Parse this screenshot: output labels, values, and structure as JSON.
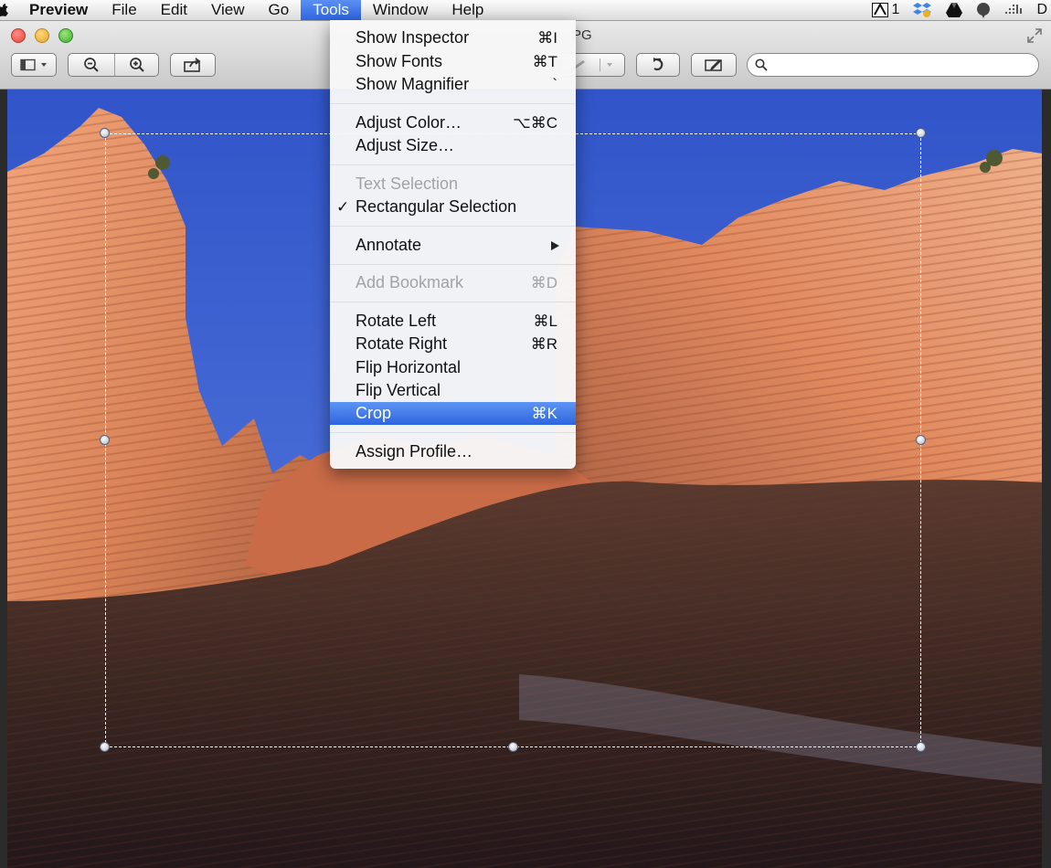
{
  "menubar": {
    "app": "Preview",
    "items": [
      "File",
      "Edit",
      "View",
      "Go",
      "Tools",
      "Window",
      "Help"
    ],
    "active": "Tools",
    "status_badge_count": "1",
    "status_partial": "D"
  },
  "window": {
    "title_fragment": "PG"
  },
  "search": {
    "placeholder": "",
    "value": ""
  },
  "tools_menu": {
    "show_inspector": {
      "label": "Show Inspector",
      "shortcut": "⌘I"
    },
    "show_fonts": {
      "label": "Show Fonts",
      "shortcut": "⌘T"
    },
    "show_magnifier": {
      "label": "Show Magnifier",
      "shortcut": "`"
    },
    "adjust_color": {
      "label": "Adjust Color…",
      "shortcut": "⌥⌘C"
    },
    "adjust_size": {
      "label": "Adjust Size…",
      "shortcut": ""
    },
    "text_selection": {
      "label": "Text Selection",
      "shortcut": ""
    },
    "rect_selection": {
      "label": "Rectangular Selection",
      "shortcut": "",
      "check": "✓"
    },
    "annotate": {
      "label": "Annotate",
      "shortcut": ""
    },
    "add_bookmark": {
      "label": "Add Bookmark",
      "shortcut": "⌘D"
    },
    "rotate_left": {
      "label": "Rotate Left",
      "shortcut": "⌘L"
    },
    "rotate_right": {
      "label": "Rotate Right",
      "shortcut": "⌘R"
    },
    "flip_horizontal": {
      "label": "Flip Horizontal",
      "shortcut": ""
    },
    "flip_vertical": {
      "label": "Flip Vertical",
      "shortcut": ""
    },
    "crop": {
      "label": "Crop",
      "shortcut": "⌘K"
    },
    "assign_profile": {
      "label": "Assign Profile…",
      "shortcut": ""
    }
  },
  "colors": {
    "menu_highlight": "#3a72e6",
    "sky": "#3a5fd0",
    "rock_light": "#e08a5e",
    "rock_shadow": "#3a2620"
  },
  "icons": {
    "sidebar_toggle": "sidebar-icon",
    "zoom_out": "zoom-out-icon",
    "zoom_in": "zoom-in-icon",
    "share": "share-icon",
    "rotate": "rotate-icon",
    "markup": "pen-icon",
    "search": "search-icon"
  }
}
